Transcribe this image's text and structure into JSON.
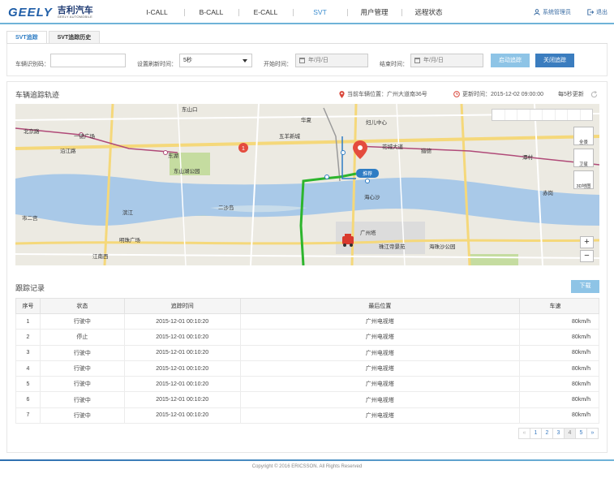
{
  "brand": {
    "logo_text": "GEELY",
    "cn_name": "吉利汽车",
    "en_name": "GEELY AUTOMOBILE",
    "accent": "#1f5ea8"
  },
  "nav": {
    "items": [
      {
        "label": "I-CALL"
      },
      {
        "label": "B-CALL"
      },
      {
        "label": "E-CALL"
      },
      {
        "label": "SVT"
      },
      {
        "label": "用户管理"
      },
      {
        "label": "远程状态"
      }
    ],
    "active_index": 3
  },
  "user": {
    "name": "系统管理员",
    "icon": "user-icon"
  },
  "logout": {
    "label": "退出",
    "icon": "logout-icon"
  },
  "tabs": [
    {
      "label": "SVT追踪"
    },
    {
      "label": "SVT追踪历史"
    }
  ],
  "filter": {
    "vin_label": "车辆识别码：",
    "vin_value": "",
    "refresh_label": "设置刷新时间：",
    "refresh_value": "5秒",
    "start_label": "开始时间：",
    "start_placeholder": "年/月/日",
    "end_label": "结束时间：",
    "end_placeholder": "年/月/日",
    "start_button": "启动追踪",
    "stop_button": "关闭追踪"
  },
  "map_section": {
    "title": "车辆追踪轨迹",
    "location_label": "当前车辆位置：",
    "location_value": "广州大道南36号",
    "update_label": "更新时间：",
    "update_value": "2015-12-02 09:00:00",
    "refresh_text": "每5秒更新"
  },
  "map": {
    "labels": {
      "beijing_road": "北京路",
      "yide_plaza": "一德广场",
      "donghu": "东湖",
      "dongshankou": "东山口",
      "huaxi": "华夏",
      "wuyang": "五羊新城",
      "zhoutou": "妇儿中心",
      "huacheng": "花城大道",
      "liede": "猎德",
      "tancun": "潭村",
      "ershadao": "二沙岛",
      "haixinsha": "海心沙",
      "guangzhou_tower": "广州塔",
      "zhujiang_dijing": "珠江帝景苑",
      "haibang": "海珠沙公园",
      "shiersan": "市二宫",
      "binjiang": "滨江",
      "mingzhu": "明珠广场",
      "dongshanhu": "东山湖公园",
      "hunan": "沿江路",
      "chigang": "赤岗",
      "tuijian": "推荐",
      "jiangnan": "江南西"
    },
    "layers": {
      "full": "全景",
      "satellite": "卫星",
      "three_d": "3D地图"
    },
    "zoom_in": "+",
    "zoom_out": "−",
    "colors": {
      "water": "#a9c9e8",
      "road_major": "#f5d87a",
      "route": "#2db52d",
      "park": "#c5dca0",
      "metro": "#b04a78"
    }
  },
  "records": {
    "title": "跟踪记录",
    "download_label": "下载",
    "columns": [
      "序号",
      "状态",
      "追踪时间",
      "最后位置",
      "车速"
    ],
    "rows": [
      [
        "1",
        "行驶中",
        "2015-12-01 00:10:20",
        "广州电视塔",
        "80km/h"
      ],
      [
        "2",
        "停止",
        "2015-12-01 00:10:20",
        "广州电视塔",
        "80km/h"
      ],
      [
        "3",
        "行驶中",
        "2015-12-01 00:10:20",
        "广州电视塔",
        "80km/h"
      ],
      [
        "4",
        "行驶中",
        "2015-12-01 00:10:20",
        "广州电视塔",
        "80km/h"
      ],
      [
        "5",
        "行驶中",
        "2015-12-01 00:10:20",
        "广州电视塔",
        "80km/h"
      ],
      [
        "6",
        "行驶中",
        "2015-12-01 00:10:20",
        "广州电视塔",
        "80km/h"
      ],
      [
        "7",
        "行驶中",
        "2015-12-01 00:10:20",
        "广州电视塔",
        "80km/h"
      ]
    ]
  },
  "pagination": {
    "prev": "«",
    "pages": [
      "1",
      "2",
      "3",
      "4",
      "5"
    ],
    "active": "4",
    "next": "»"
  },
  "footer": {
    "copyright": "Copyright © 2016 ERICSSON. All Rights Reserved"
  }
}
